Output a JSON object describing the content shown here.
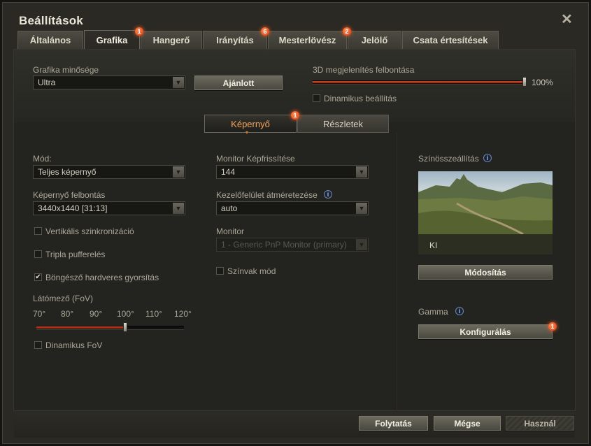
{
  "window": {
    "title": "Beállítások"
  },
  "tabs": [
    {
      "label": "Általános"
    },
    {
      "label": "Grafika",
      "badge": "1"
    },
    {
      "label": "Hangerő"
    },
    {
      "label": "Irányítás",
      "badge": "6"
    },
    {
      "label": "Mesterlövész",
      "badge": "2"
    },
    {
      "label": "Jelölő"
    },
    {
      "label": "Csata értesítések"
    }
  ],
  "graphics": {
    "quality_label": "Grafika minősége",
    "quality_value": "Ultra",
    "recommended_button": "Ajánlott",
    "resolution3d_label": "3D megjelenítés felbontása",
    "resolution3d_value": "100%",
    "resolution3d_fraction": 1.0,
    "dynamic_label": "Dinamikus beállítás"
  },
  "subtabs": [
    {
      "label": "Képernyő",
      "badge": "1"
    },
    {
      "label": "Részletek"
    }
  ],
  "screen": {
    "mode_label": "Mód:",
    "mode_value": "Teljes képernyő",
    "resolution_label": "Képernyő felbontás",
    "resolution_value": "3440x1440 [31:13]",
    "vsync_label": "Vertikális szinkronizáció",
    "triple_label": "Tripla pufferelés",
    "browser_hw_label": "Böngésző hardveres gyorsítás",
    "fov_label": "Látómező (FoV)",
    "fov_ticks": [
      "70°",
      "80°",
      "90°",
      "100°",
      "110°",
      "120°"
    ],
    "fov_fraction": 0.6,
    "dynamic_fov_label": "Dinamikus FoV",
    "refresh_label": "Monitor Képfrissítése",
    "refresh_value": "144",
    "ui_scale_label": "Kezelőfelület átméretezése",
    "ui_scale_value": "auto",
    "monitor_label": "Monitor",
    "monitor_value": "1 - Generic PnP Monitor (primary)",
    "colorblind_label": "Színvak mód"
  },
  "color": {
    "label": "Színösszeállítás",
    "preview_caption": "KI",
    "modify_button": "Módosítás",
    "gamma_label": "Gamma",
    "configure_button": "Konfigurálás",
    "configure_badge": "1"
  },
  "footer": {
    "continue_button": "Folytatás",
    "cancel_button": "Mégse",
    "apply_button": "Használ"
  }
}
